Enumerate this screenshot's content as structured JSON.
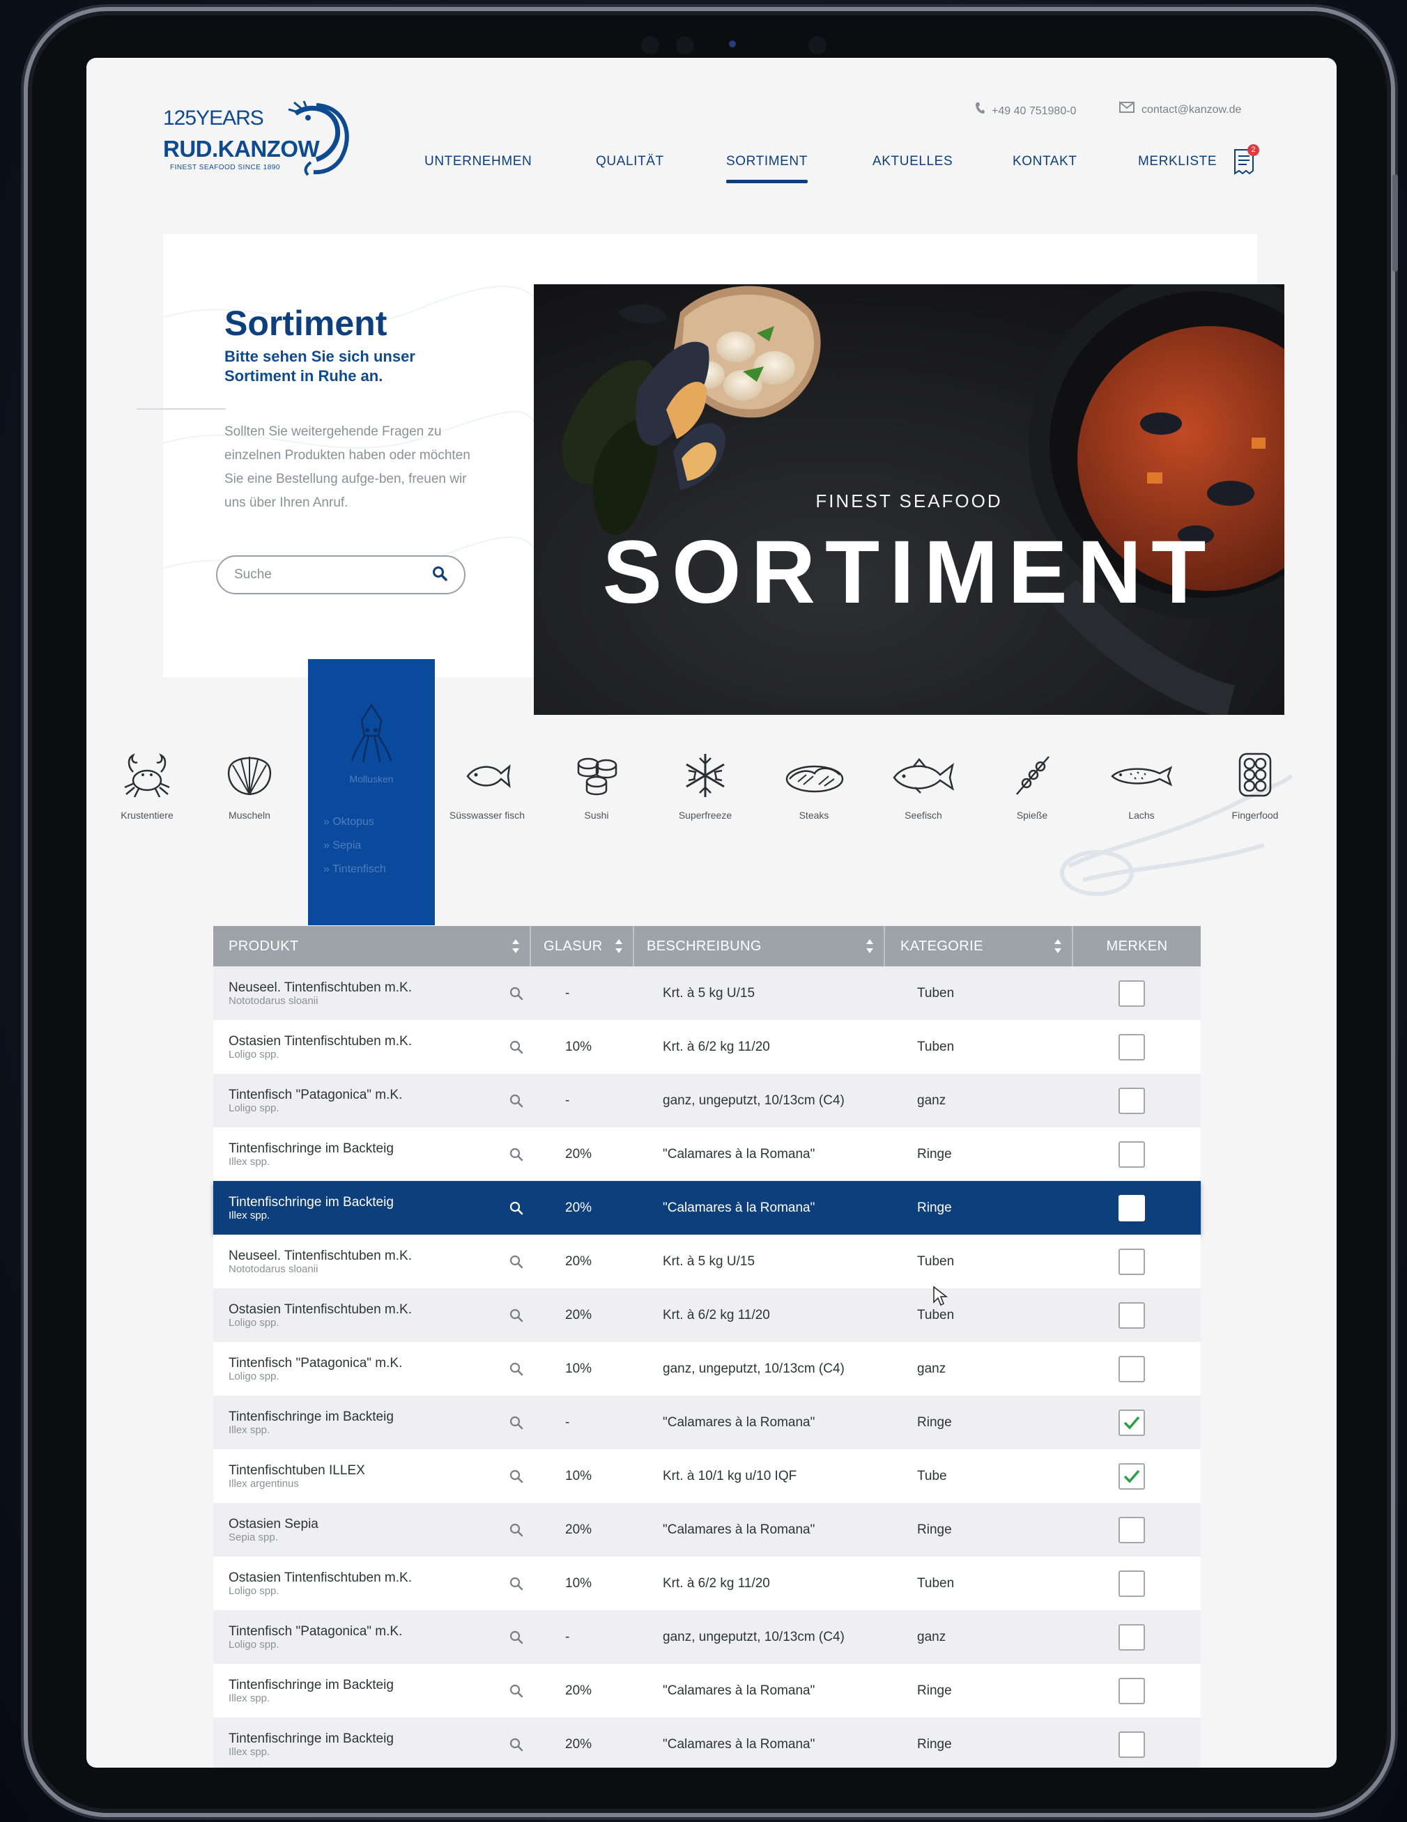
{
  "brand": {
    "years": "125YEARS",
    "name": "RUD.KANZOW",
    "tagline": "FINEST SEAFOOD SINCE 1890"
  },
  "contact": {
    "phone": "+49 40 751980-0",
    "email": "contact@kanzow.de"
  },
  "nav": {
    "items": [
      "UNTERNEHMEN",
      "QUALITÄT",
      "SORTIMENT",
      "AKTUELLES",
      "KONTAKT",
      "MERKLISTE"
    ],
    "active": "SORTIMENT",
    "merkliste_count": "2"
  },
  "intro": {
    "title": "Sortiment",
    "subtitle": "Bitte sehen Sie sich unser Sortiment in Ruhe an.",
    "body": "Sollten Sie weitergehende Fragen zu einzelnen Produkten haben oder möchten Sie eine Bestellung aufge-ben, freuen wir uns über Ihren Anruf."
  },
  "search": {
    "placeholder": "Suche",
    "value": ""
  },
  "hero": {
    "kicker": "FINEST SEAFOOD",
    "title": "SORTIMENT"
  },
  "categories": {
    "items": [
      {
        "label": "Krustentiere",
        "icon": "crab-icon"
      },
      {
        "label": "Muscheln",
        "icon": "shell-icon"
      },
      {
        "label": "Mollusken",
        "icon": "squid-icon"
      },
      {
        "label": "Süsswasser fisch",
        "icon": "fish-icon"
      },
      {
        "label": "Sushi",
        "icon": "sushi-icon"
      },
      {
        "label": "Superfreeze",
        "icon": "snowflake-icon"
      },
      {
        "label": "Steaks",
        "icon": "steak-icon"
      },
      {
        "label": "Seefisch",
        "icon": "seafish-icon"
      },
      {
        "label": "Spieße",
        "icon": "skewer-icon"
      },
      {
        "label": "Lachs",
        "icon": "salmon-icon"
      },
      {
        "label": "Fingerfood",
        "icon": "fingerfood-icon"
      }
    ],
    "active": "Mollusken",
    "subcategories": [
      "» Oktopus",
      "» Sepia",
      "» Tintenfisch"
    ]
  },
  "table": {
    "headers": {
      "produkt": "PRODUKT",
      "glasur": "GLASUR",
      "beschreibung": "BESCHREIBUNG",
      "kategorie": "KATEGORIE",
      "merken": "MERKEN"
    },
    "rows": [
      {
        "name": "Neuseel. Tintenfischtuben m.K.",
        "sci": "Nototodarus sloanii",
        "glasur": "-",
        "beschreibung": "Krt. à 5 kg U/15",
        "kategorie": "Tuben",
        "merken": false,
        "selected": false
      },
      {
        "name": "Ostasien Tintenfischtuben m.K.",
        "sci": "Loligo spp.",
        "glasur": "10%",
        "beschreibung": "Krt. à 6/2 kg 11/20",
        "kategorie": "Tuben",
        "merken": false,
        "selected": false
      },
      {
        "name": "Tintenfisch \"Patagonica\" m.K.",
        "sci": "Loligo spp.",
        "glasur": "-",
        "beschreibung": "ganz, ungeputzt, 10/13cm (C4)",
        "kategorie": "ganz",
        "merken": false,
        "selected": false
      },
      {
        "name": "Tintenfischringe im Backteig",
        "sci": "Illex spp.",
        "glasur": "20%",
        "beschreibung": "\"Calamares à la Romana\"",
        "kategorie": "Ringe",
        "merken": false,
        "selected": false
      },
      {
        "name": "Tintenfischringe im Backteig",
        "sci": "Illex spp.",
        "glasur": "20%",
        "beschreibung": "\"Calamares à la Romana\"",
        "kategorie": "Ringe",
        "merken": false,
        "selected": true
      },
      {
        "name": "Neuseel. Tintenfischtuben m.K.",
        "sci": "Nototodarus sloanii",
        "glasur": "20%",
        "beschreibung": "Krt. à 5 kg U/15",
        "kategorie": "Tuben",
        "merken": false,
        "selected": false
      },
      {
        "name": "Ostasien Tintenfischtuben m.K.",
        "sci": "Loligo spp.",
        "glasur": "20%",
        "beschreibung": "Krt. à 6/2 kg 11/20",
        "kategorie": "Tuben",
        "merken": false,
        "selected": false
      },
      {
        "name": "Tintenfisch \"Patagonica\" m.K.",
        "sci": "Loligo spp.",
        "glasur": "10%",
        "beschreibung": "ganz, ungeputzt, 10/13cm (C4)",
        "kategorie": "ganz",
        "merken": false,
        "selected": false
      },
      {
        "name": "Tintenfischringe im Backteig",
        "sci": "Illex spp.",
        "glasur": "-",
        "beschreibung": "\"Calamares à la Romana\"",
        "kategorie": "Ringe",
        "merken": true,
        "selected": false
      },
      {
        "name": "Tintenfischtuben ILLEX",
        "sci": "Illex argentinus",
        "glasur": "10%",
        "beschreibung": "Krt. à 10/1 kg u/10 IQF",
        "kategorie": "Tube",
        "merken": true,
        "selected": false
      },
      {
        "name": "Ostasien Sepia",
        "sci": "Sepia spp.",
        "glasur": "20%",
        "beschreibung": "\"Calamares à la Romana\"",
        "kategorie": "Ringe",
        "merken": false,
        "selected": false
      },
      {
        "name": "Ostasien Tintenfischtuben m.K.",
        "sci": "Loligo spp.",
        "glasur": "10%",
        "beschreibung": "Krt. à 6/2 kg 11/20",
        "kategorie": "Tuben",
        "merken": false,
        "selected": false
      },
      {
        "name": "Tintenfisch \"Patagonica\" m.K.",
        "sci": "Loligo spp.",
        "glasur": "-",
        "beschreibung": "ganz, ungeputzt, 10/13cm (C4)",
        "kategorie": "ganz",
        "merken": false,
        "selected": false
      },
      {
        "name": "Tintenfischringe im Backteig",
        "sci": "Illex spp.",
        "glasur": "20%",
        "beschreibung": "\"Calamares à la Romana\"",
        "kategorie": "Ringe",
        "merken": false,
        "selected": false
      },
      {
        "name": "Tintenfischringe im Backteig",
        "sci": "Illex spp.",
        "glasur": "20%",
        "beschreibung": "\"Calamares à la Romana\"",
        "kategorie": "Ringe",
        "merken": false,
        "selected": false
      }
    ]
  },
  "colors": {
    "brand_blue": "#0d3f7c",
    "active_category": "#0a4a9c",
    "table_header": "#9ea2a9",
    "check_green": "#2e9e4a",
    "badge_red": "#e4393c"
  }
}
